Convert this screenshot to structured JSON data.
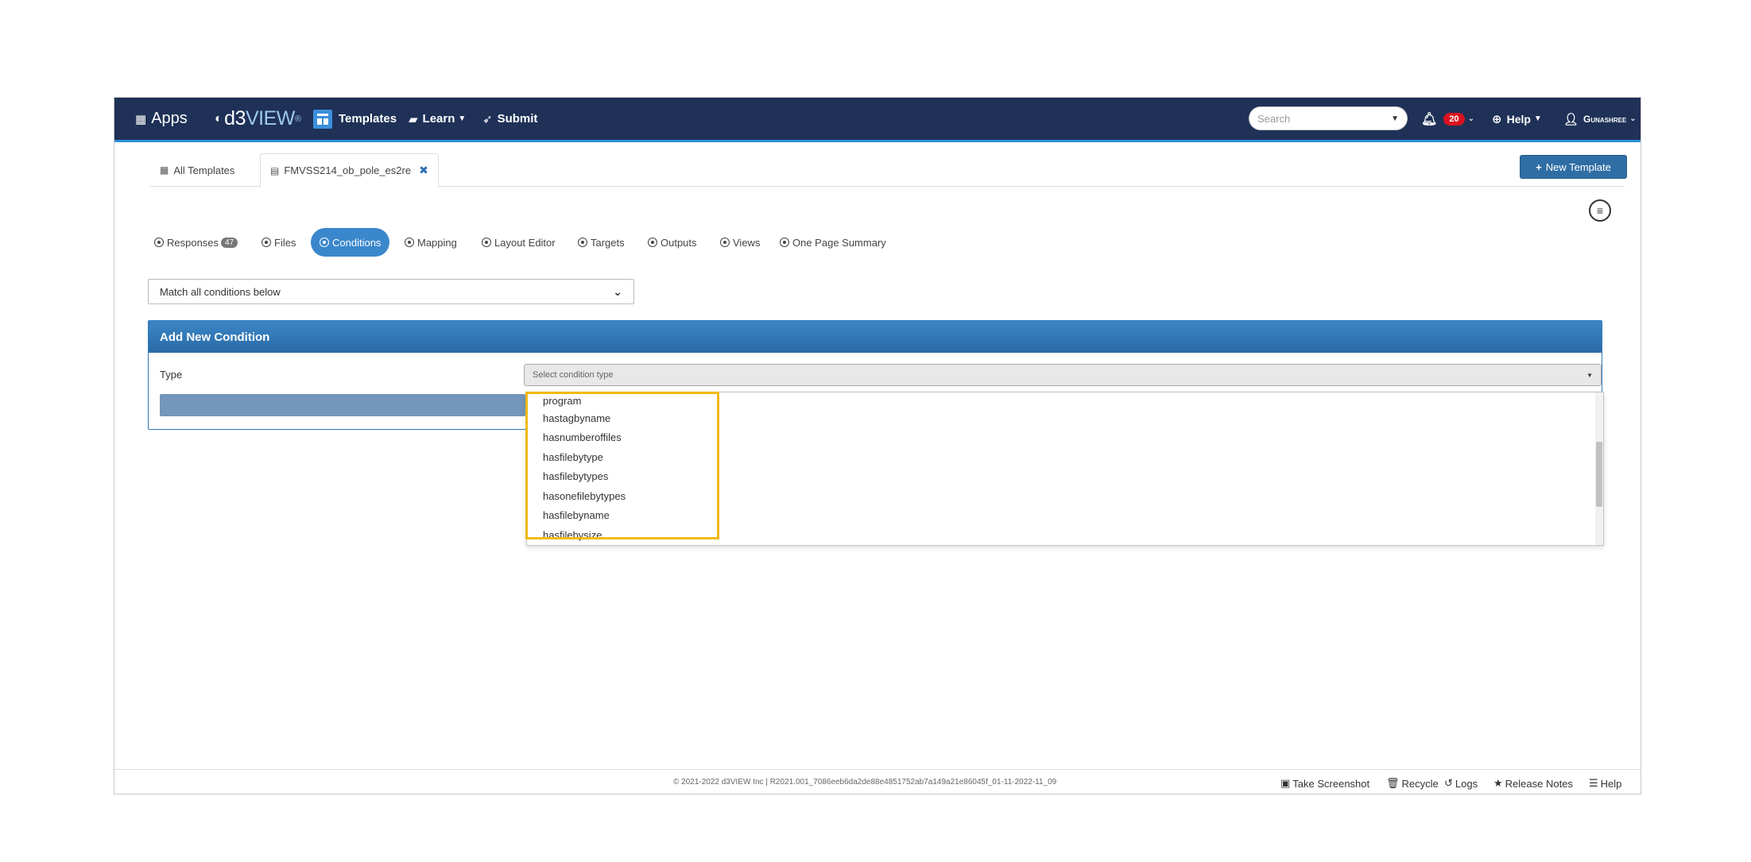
{
  "navbar": {
    "apps_label": "Apps",
    "logo_d3": "d3",
    "logo_view": "VIEW",
    "logo_reg": "®",
    "templates_label": "Templates",
    "learn_label": "Learn",
    "submit_label": "Submit",
    "search_placeholder": "Search",
    "notification_count": "20",
    "help_label": "Help",
    "user_label": "Gunashree"
  },
  "tabs": {
    "all_templates": "All Templates",
    "active_tab": "FMVSS214_ob_pole_es2re",
    "close": "✖"
  },
  "new_template_label": "New Template",
  "sections": [
    {
      "label": "Responses",
      "badge": "47"
    },
    {
      "label": "Files"
    },
    {
      "label": "Conditions"
    },
    {
      "label": "Mapping"
    },
    {
      "label": "Layout Editor"
    },
    {
      "label": "Targets"
    },
    {
      "label": "Outputs"
    },
    {
      "label": "Views"
    },
    {
      "label": "One Page Summary"
    }
  ],
  "match_select": {
    "value": "Match all conditions below"
  },
  "panel": {
    "title": "Add New Condition",
    "type_label": "Type",
    "type_placeholder": "Select condition type"
  },
  "dropdown_options": [
    "program",
    "hastagbyname",
    "hasnumberoffiles",
    "hasfilebytype",
    "hasfilebytypes",
    "hasonefilebytypes",
    "hasfilebyname",
    "hasfilebysize"
  ],
  "footer": {
    "copyright": "© 2021-2022 d3VIEW Inc | R2021.001_7086eeb6da2de88e4851752ab7a149a21e86045f_01-11-2022-11_09",
    "take_screenshot": "Take Screenshot",
    "recycle": "Recycle",
    "logs": "Logs",
    "release_notes": "Release Notes",
    "help": "Help"
  },
  "colors": {
    "navbar_bg": "#1f3157",
    "accent": "#3a87cc",
    "highlight": "#f2b90f",
    "badge_red": "#d9121f"
  }
}
